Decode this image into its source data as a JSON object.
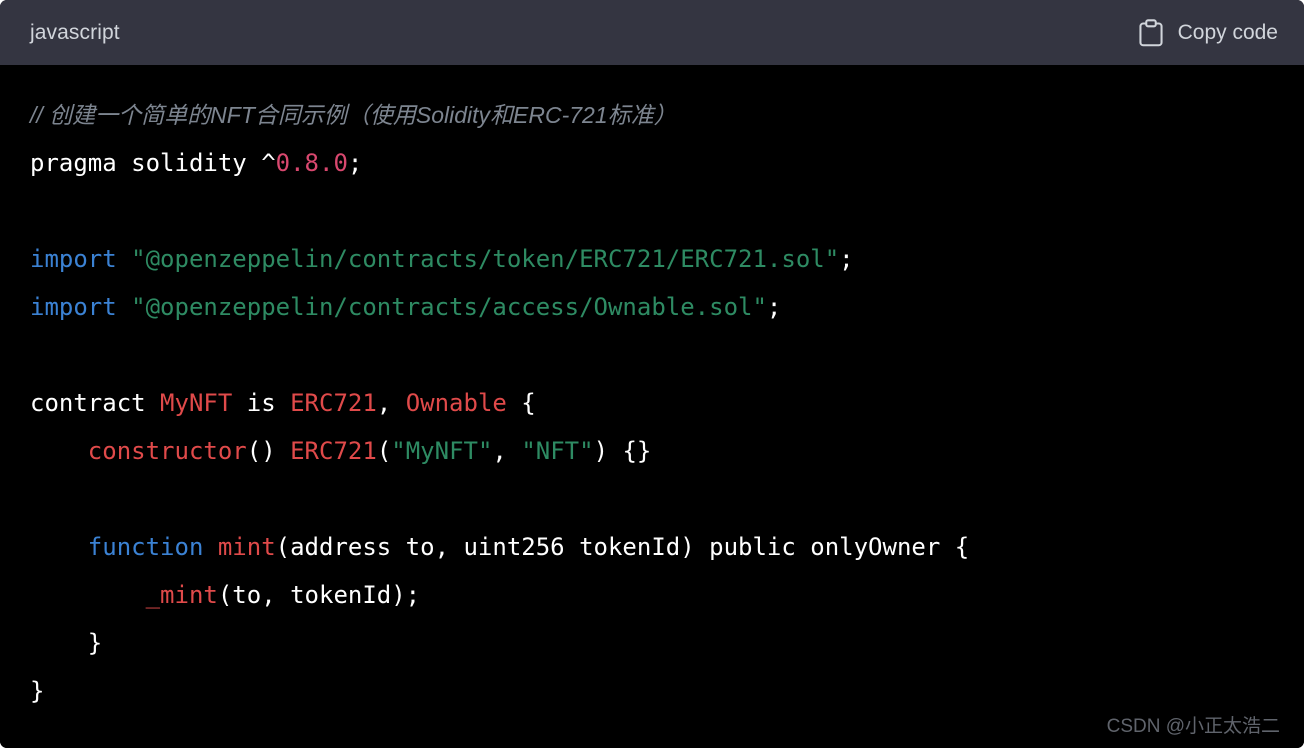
{
  "header": {
    "language": "javascript",
    "copy_label": "Copy code",
    "copy_icon": "clipboard-icon",
    "background_color": "#343541",
    "text_color": "#d1d5db"
  },
  "code": {
    "background_color": "#000000",
    "colors": {
      "comment": "#7d8590",
      "keyword": "#3b82d4",
      "string": "#2e8b63",
      "number": "#d9486f",
      "type": "#e04a4a",
      "plain": "#ffffff"
    },
    "lines": [
      {
        "tokens": [
          {
            "t": "// 创建一个简单的NFT合同示例（使用Solidity和ERC-721标准）",
            "k": "comment"
          }
        ]
      },
      {
        "tokens": [
          {
            "t": "pragma solidity ^",
            "k": "plain"
          },
          {
            "t": "0.8.0",
            "k": "number"
          },
          {
            "t": ";",
            "k": "plain"
          }
        ]
      },
      {
        "tokens": []
      },
      {
        "tokens": [
          {
            "t": "import",
            "k": "keyword"
          },
          {
            "t": " ",
            "k": "plain"
          },
          {
            "t": "\"@openzeppelin/contracts/token/ERC721/ERC721.sol\"",
            "k": "string"
          },
          {
            "t": ";",
            "k": "plain"
          }
        ]
      },
      {
        "tokens": [
          {
            "t": "import",
            "k": "keyword"
          },
          {
            "t": " ",
            "k": "plain"
          },
          {
            "t": "\"@openzeppelin/contracts/access/Ownable.sol\"",
            "k": "string"
          },
          {
            "t": ";",
            "k": "plain"
          }
        ]
      },
      {
        "tokens": []
      },
      {
        "tokens": [
          {
            "t": "contract ",
            "k": "plain"
          },
          {
            "t": "MyNFT",
            "k": "type"
          },
          {
            "t": " is ",
            "k": "plain"
          },
          {
            "t": "ERC721",
            "k": "type"
          },
          {
            "t": ", ",
            "k": "plain"
          },
          {
            "t": "Ownable",
            "k": "type"
          },
          {
            "t": " {",
            "k": "plain"
          }
        ]
      },
      {
        "tokens": [
          {
            "t": "    ",
            "k": "plain"
          },
          {
            "t": "constructor",
            "k": "type"
          },
          {
            "t": "() ",
            "k": "plain"
          },
          {
            "t": "ERC721",
            "k": "type"
          },
          {
            "t": "(",
            "k": "plain"
          },
          {
            "t": "\"MyNFT\"",
            "k": "string"
          },
          {
            "t": ", ",
            "k": "plain"
          },
          {
            "t": "\"NFT\"",
            "k": "string"
          },
          {
            "t": ") {}",
            "k": "plain"
          }
        ]
      },
      {
        "tokens": []
      },
      {
        "tokens": [
          {
            "t": "    ",
            "k": "plain"
          },
          {
            "t": "function",
            "k": "keyword"
          },
          {
            "t": " ",
            "k": "plain"
          },
          {
            "t": "mint",
            "k": "type"
          },
          {
            "t": "(address to, uint256 tokenId) public onlyOwner {",
            "k": "plain"
          }
        ]
      },
      {
        "tokens": [
          {
            "t": "        ",
            "k": "plain"
          },
          {
            "t": "_mint",
            "k": "type"
          },
          {
            "t": "(to, tokenId);",
            "k": "plain"
          }
        ]
      },
      {
        "tokens": [
          {
            "t": "    }",
            "k": "plain"
          }
        ]
      },
      {
        "tokens": [
          {
            "t": "}",
            "k": "plain"
          }
        ]
      }
    ]
  },
  "watermark": {
    "text": "CSDN @小正太浩二"
  }
}
